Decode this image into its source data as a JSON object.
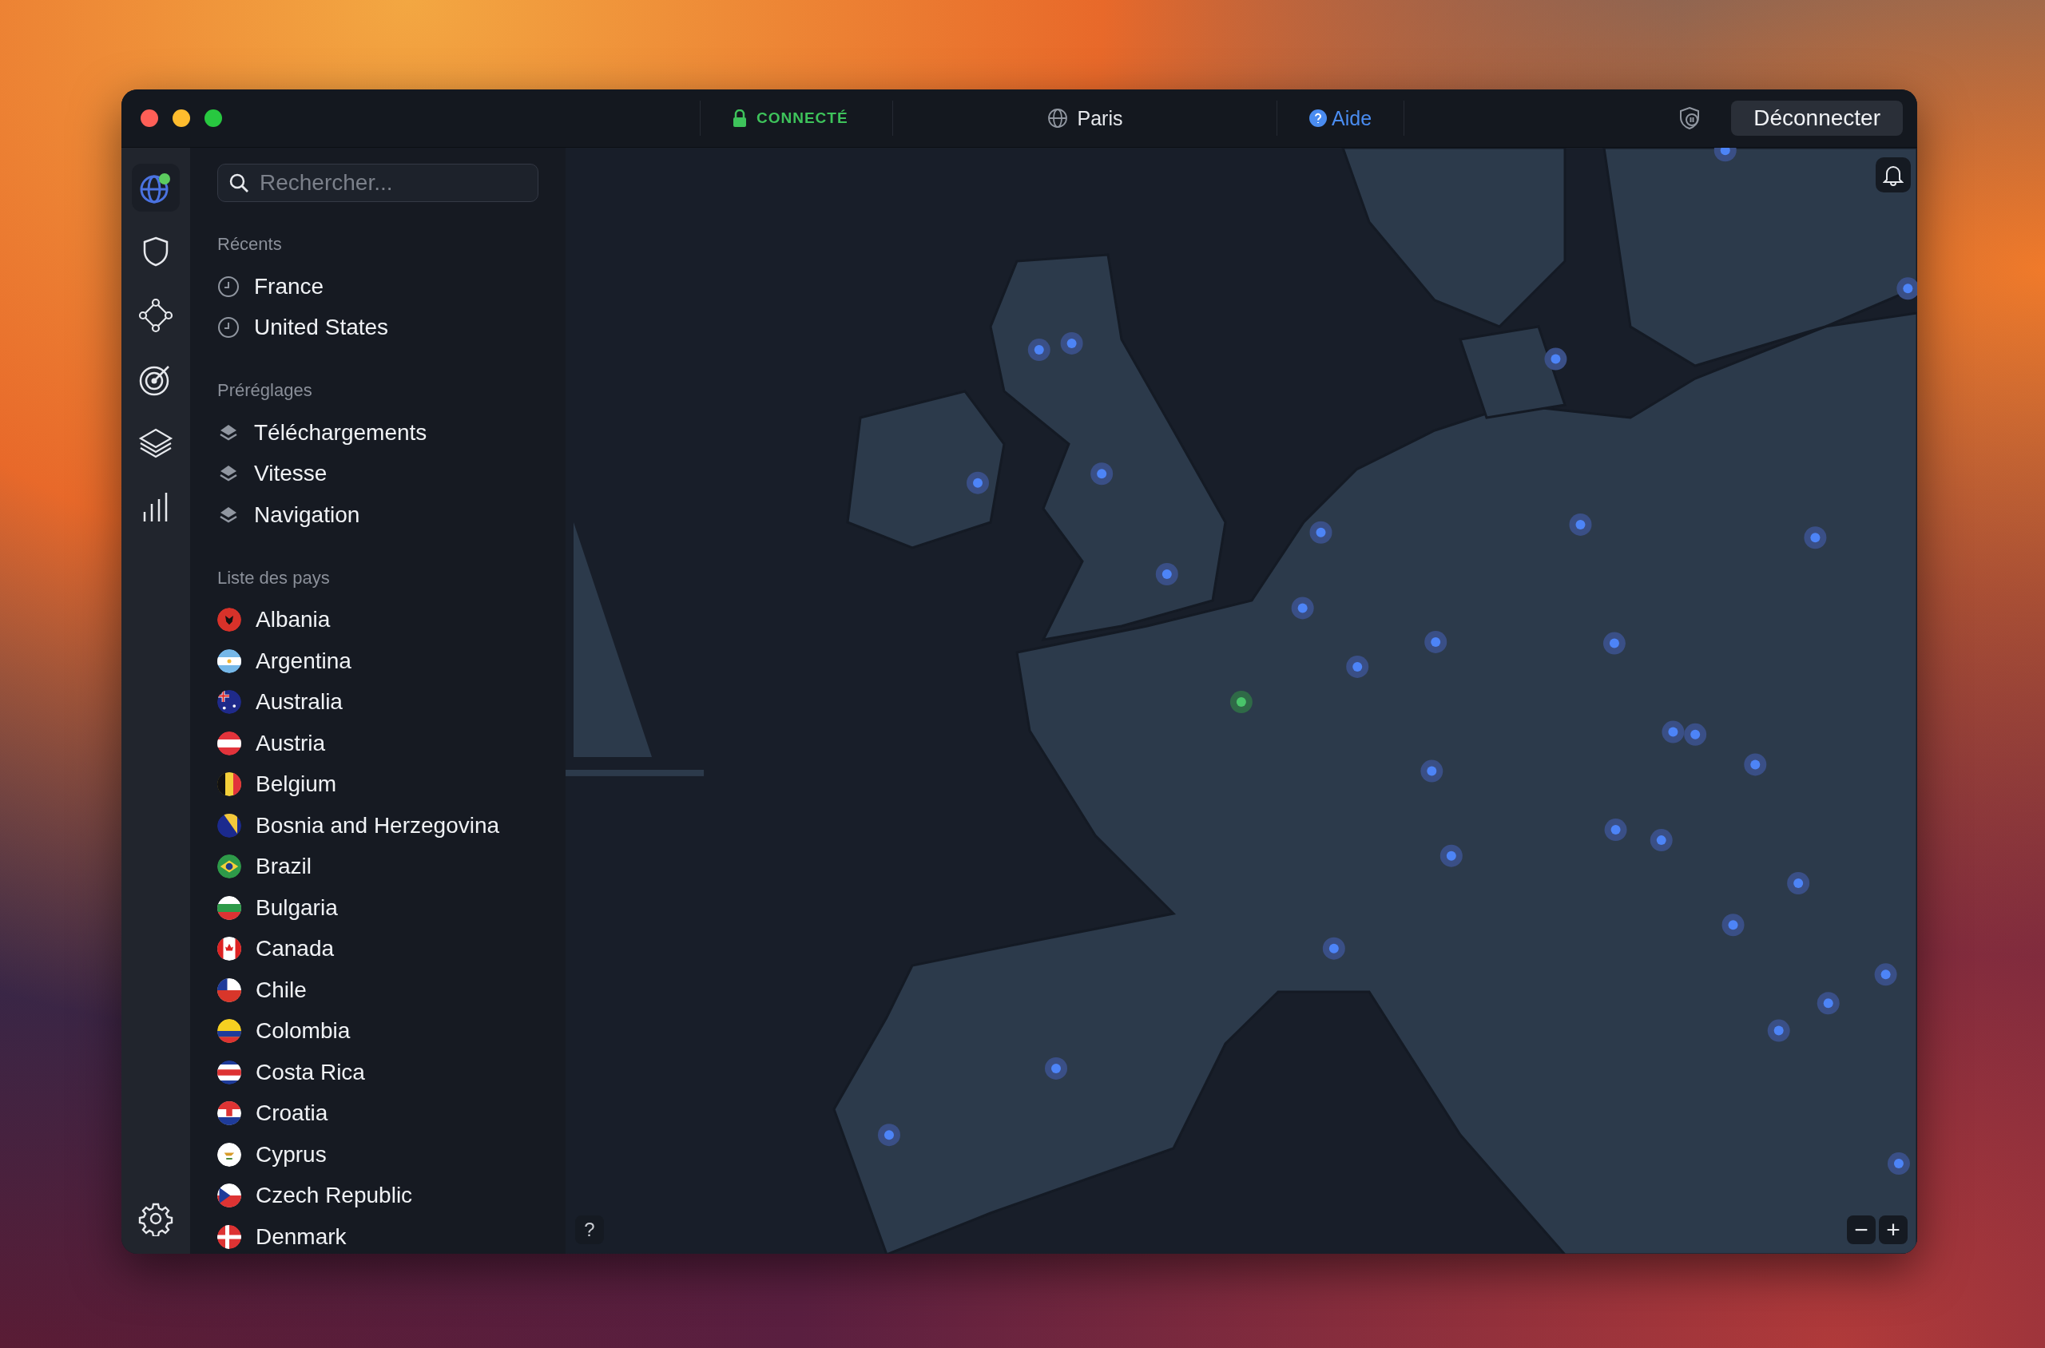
{
  "titlebar": {
    "status": "CONNECTÉ",
    "connected": true,
    "location": "Paris",
    "help": "Aide",
    "disconnect": "Déconnecter"
  },
  "search": {
    "placeholder": "Rechercher..."
  },
  "sections": [
    {
      "title": "Récents",
      "kind": "recent",
      "items": [
        "France",
        "United States"
      ]
    },
    {
      "title": "Préréglages",
      "kind": "preset",
      "items": [
        "Téléchargements",
        "Vitesse",
        "Navigation"
      ]
    },
    {
      "title": "Liste des pays",
      "kind": "country",
      "items": [
        "Albania",
        "Argentina",
        "Australia",
        "Austria",
        "Belgium",
        "Bosnia and Herzegovina",
        "Brazil",
        "Bulgaria",
        "Canada",
        "Chile",
        "Colombia",
        "Costa Rica",
        "Croatia",
        "Cyprus",
        "Czech Republic",
        "Denmark"
      ]
    }
  ],
  "map": {
    "help": "?",
    "zoom_out": "−",
    "zoom_in": "+"
  }
}
